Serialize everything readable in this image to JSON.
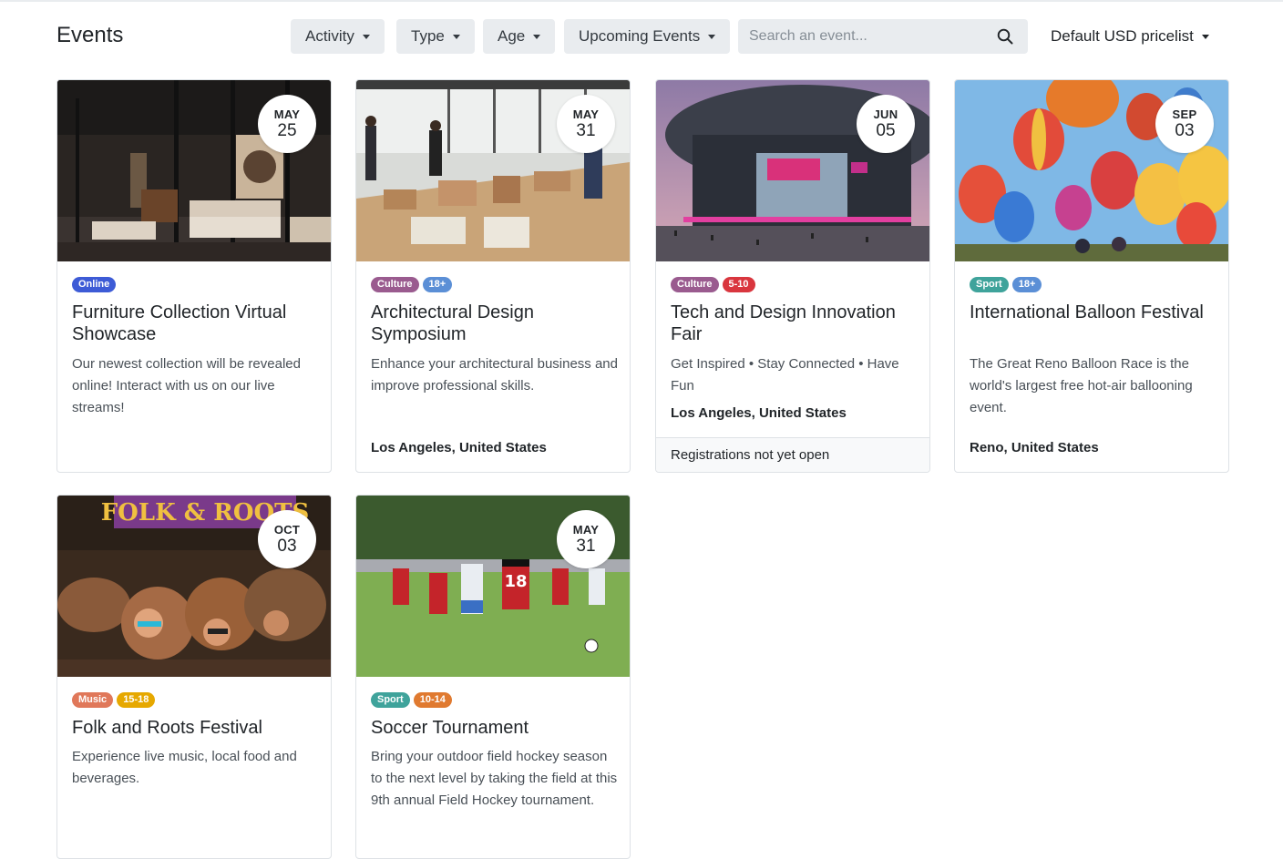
{
  "header": {
    "title": "Events",
    "filters": {
      "activity": "Activity",
      "type": "Type",
      "age": "Age",
      "when": "Upcoming Events"
    },
    "search": {
      "placeholder": "Search an event..."
    },
    "pricelist": "Default USD pricelist"
  },
  "colors": {
    "online": "#3d5bd6",
    "culture": "#9a5b8f",
    "age18": "#5b8fd6",
    "age510": "#d9363e",
    "sport": "#3fa39b",
    "music": "#e0785a",
    "age1518": "#e6a800",
    "age1014": "#e07a30"
  },
  "events": [
    {
      "month": "MAY",
      "day": "25",
      "tags": [
        "Online"
      ],
      "title": "Furniture Collection Virtual Showcase",
      "description": "Our newest collection will be revealed online! Interact with us on our live streams!",
      "location": "",
      "footer": ""
    },
    {
      "month": "MAY",
      "day": "31",
      "tags": [
        "Culture",
        "18+"
      ],
      "title": "Architectural Design Symposium",
      "description": "Enhance your architectural business and improve professional skills.",
      "location": "Los Angeles, United States",
      "footer": ""
    },
    {
      "month": "JUN",
      "day": "05",
      "tags": [
        "Culture",
        "5-10"
      ],
      "title": "Tech and Design Innovation Fair",
      "description": "Get Inspired • Stay Connected • Have Fun",
      "location": "Los Angeles, United States",
      "footer": "Registrations not yet open"
    },
    {
      "month": "SEP",
      "day": "03",
      "tags": [
        "Sport",
        "18+"
      ],
      "title": "International Balloon Festival",
      "description": "The Great Reno Balloon Race is the world's largest free hot-air ballooning event.",
      "location": "Reno, United States",
      "footer": ""
    },
    {
      "month": "OCT",
      "day": "03",
      "tags": [
        "Music",
        "15-18"
      ],
      "title": "Folk and Roots Festival",
      "description": "Experience live music, local food and beverages.",
      "location": "",
      "footer": "",
      "banner_text": "FOLK & ROOTS"
    },
    {
      "month": "MAY",
      "day": "31",
      "tags": [
        "Sport",
        "10-14"
      ],
      "title": "Soccer Tournament",
      "description": "Bring your outdoor field hockey season to the next level by taking the field at this 9th annual Field Hockey tournament.",
      "location": "",
      "footer": "",
      "jersey_number": "18"
    }
  ]
}
